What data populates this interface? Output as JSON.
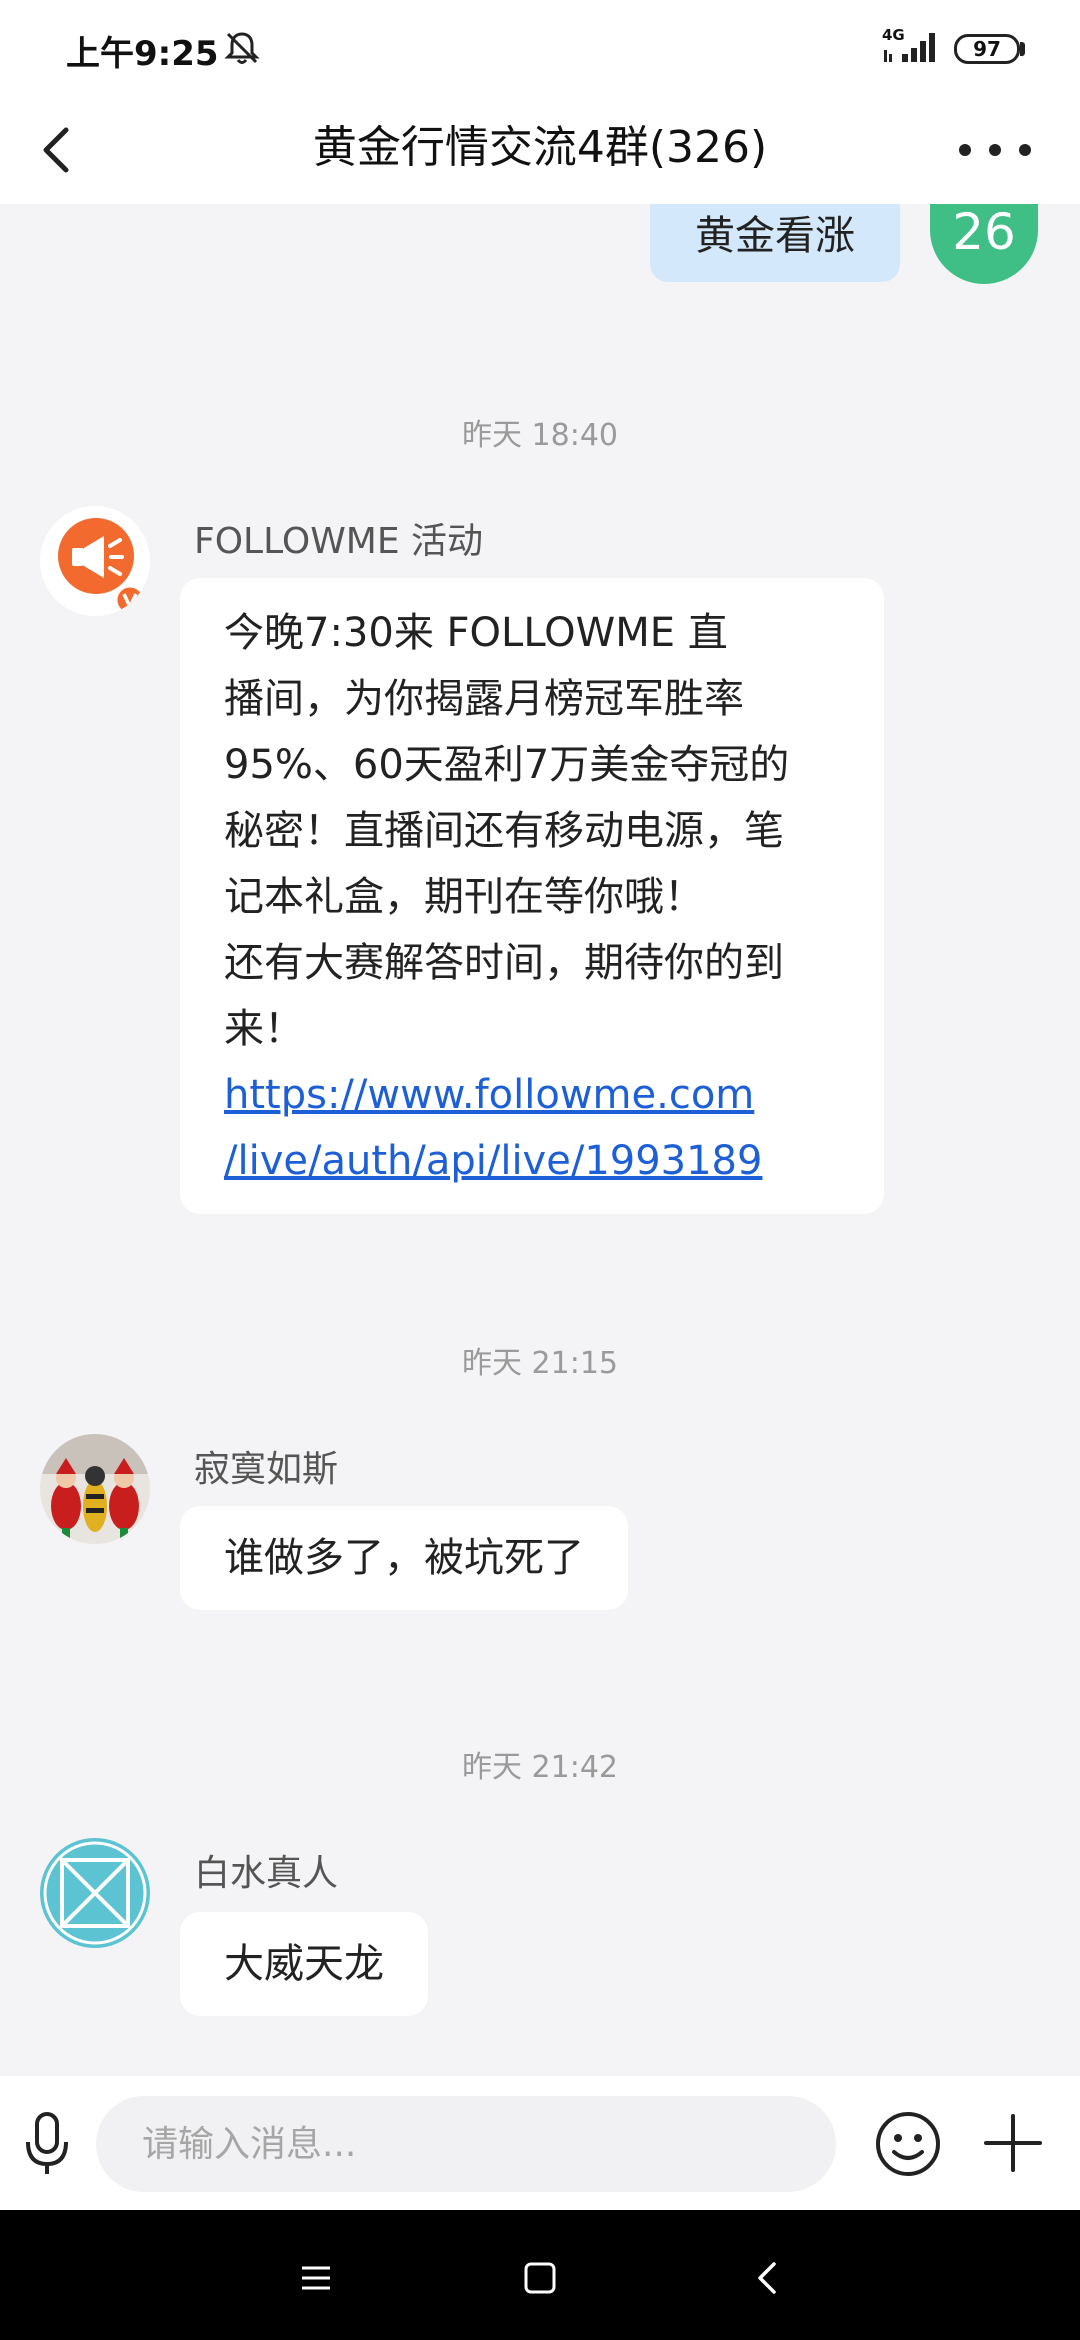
{
  "status_bar": {
    "time": "上午9:25",
    "network": "4G",
    "battery": "97",
    "icons": [
      "mute-bell-icon",
      "signal-icon",
      "battery-icon"
    ]
  },
  "header": {
    "title": "黄金行情交流4群(326)",
    "icons": [
      "back-arrow-icon",
      "more-dots-icon"
    ]
  },
  "partial_message": {
    "text": "黄金看涨",
    "avatar_text": "26",
    "avatar_color": "#3fbf86",
    "bubble_color": "#d4e8fb"
  },
  "messages": [
    {
      "time": "昨天 18:40",
      "sender": "FOLLOWME 活动",
      "avatar": "megaphone-verified-icon",
      "lines": [
        "今晚7:30来 FOLLOWME 直",
        "播间，为你揭露月榜冠军胜率",
        "95%、60天盈利7万美金夺冠的",
        "秘密！直播间还有移动电源，笔",
        "记本礼盒，期刊在等你哦！",
        "还有大赛解答时间，期待你的到",
        "来！"
      ],
      "link_lines": [
        "https://www.followme.com",
        "/live/auth/api/live/1993189"
      ]
    },
    {
      "time": "昨天 21:15",
      "sender": "寂寞如斯",
      "avatar": "santa-figures-photo",
      "text": "谁做多了，被坑死了"
    },
    {
      "time": "昨天 21:42",
      "sender": "白水真人",
      "avatar": "teal-x-pattern-icon",
      "text": "大威天龙"
    }
  ],
  "input_bar": {
    "placeholder": "请输入消息...",
    "icons": [
      "microphone-icon",
      "emoji-icon",
      "plus-icon"
    ]
  },
  "system_nav": {
    "icons": [
      "menu-icon",
      "home-square-icon",
      "back-chevron-icon"
    ]
  },
  "colors": {
    "background": "#f4f4f6",
    "link": "#1d5fd6",
    "megaphone_orange": "#f26a2e",
    "teal": "#5bc3d1"
  }
}
